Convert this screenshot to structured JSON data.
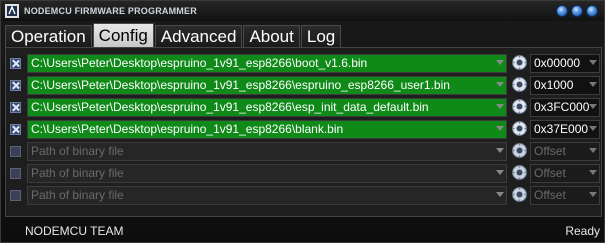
{
  "window": {
    "title": "NODEMCU FIRMWARE PROGRAMMER"
  },
  "tabs": [
    {
      "label": "Operation",
      "active": false
    },
    {
      "label": "Config",
      "active": true
    },
    {
      "label": "Advanced",
      "active": false
    },
    {
      "label": "About",
      "active": false
    },
    {
      "label": "Log",
      "active": false
    }
  ],
  "rows": [
    {
      "checked": true,
      "path": "C:\\Users\\Peter\\Desktop\\espruino_1v91_esp8266\\boot_v1.6.bin",
      "offset": "0x00000"
    },
    {
      "checked": true,
      "path": "C:\\Users\\Peter\\Desktop\\espruino_1v91_esp8266\\espruino_esp8266_user1.bin",
      "offset": "0x1000"
    },
    {
      "checked": true,
      "path": "C:\\Users\\Peter\\Desktop\\espruino_1v91_esp8266\\esp_init_data_default.bin",
      "offset": "0x3FC000"
    },
    {
      "checked": true,
      "path": "C:\\Users\\Peter\\Desktop\\espruino_1v91_esp8266\\blank.bin",
      "offset": "0x37E000"
    },
    {
      "checked": false,
      "path": "",
      "path_placeholder": "Path of binary file",
      "offset": "",
      "offset_placeholder": "Offset"
    },
    {
      "checked": false,
      "path": "",
      "path_placeholder": "Path of binary file",
      "offset": "",
      "offset_placeholder": "Offset"
    },
    {
      "checked": false,
      "path": "",
      "path_placeholder": "Path of binary file",
      "offset": "",
      "offset_placeholder": "Offset"
    }
  ],
  "status": {
    "left": "NODEMCU TEAM",
    "right": "Ready"
  },
  "colors": {
    "filled_row": "#0f8a18",
    "accent": "#5f9be6"
  }
}
